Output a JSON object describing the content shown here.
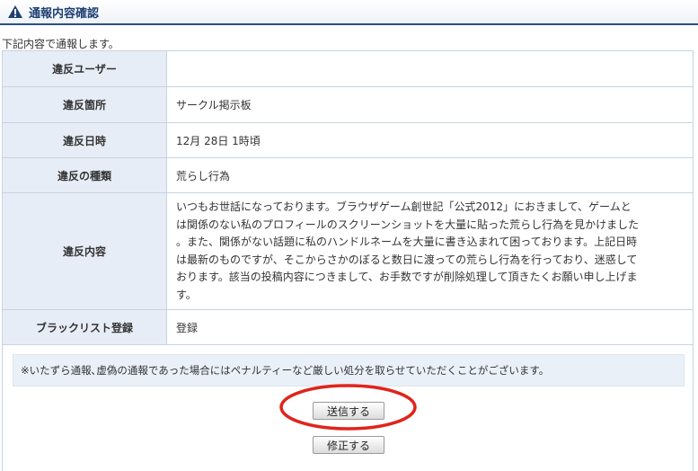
{
  "header": {
    "title": "通報内容確認",
    "icon": "warning-icon"
  },
  "intro_text": "下記内容で通報します。",
  "rows": [
    {
      "label": "違反ユーザー",
      "value": ""
    },
    {
      "label": "違反箇所",
      "value": "サークル掲示板"
    },
    {
      "label": "違反日時",
      "value": "12月 28日 1時頃"
    },
    {
      "label": "違反の種類",
      "value": "荒らし行為"
    },
    {
      "label": "違反内容",
      "lines": [
        "いつもお世話になっております。ブラウザゲーム創世記「公式2012」におきまして、ゲームと",
        "は関係のない私のプロフィールのスクリーンショットを大量に貼った荒らし行為を見かけました",
        "。また、関係がない話題に私のハンドルネームを大量に書き込まれて困っております。上記日時",
        "は最新のものですが、そこからさかのぼると数日に渡っての荒らし行為を行っており、迷惑して",
        "おります。該当の投稿内容につきまして、お手数ですが削除処理して頂きたくお願い申し上げま",
        "す。"
      ]
    },
    {
      "label": "ブラックリスト登録",
      "value": "登録"
    }
  ],
  "notice": "※いたずら通報､虚偽の通報であった場合にはペナルティーなど厳しい処分を取らせていただくことがございます。",
  "buttons": {
    "submit": "送信する",
    "edit": "修正する"
  },
  "colors": {
    "accent": "#2b4e86",
    "label_bg": "#e7edf6",
    "annotation": "#e0241c"
  }
}
